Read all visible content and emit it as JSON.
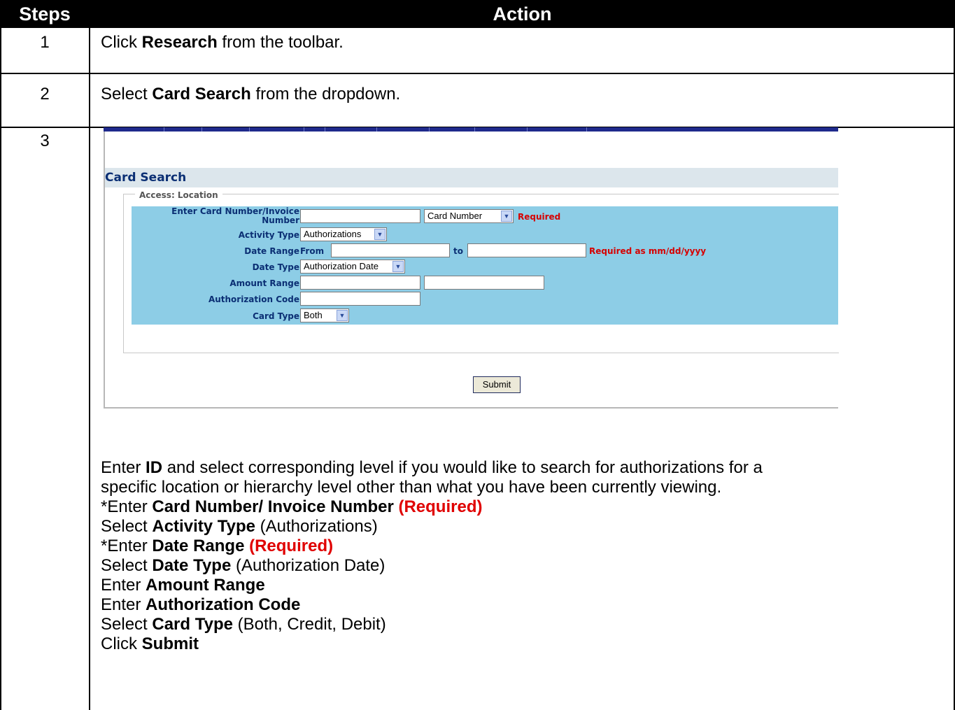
{
  "header": {
    "steps": "Steps",
    "action": "Action"
  },
  "rows": [
    {
      "num": "1",
      "pre": "Click ",
      "bold": "Research",
      "post": " from the toolbar."
    },
    {
      "num": "2",
      "pre": "Select ",
      "bold": "Card Search",
      "post": " from the dropdown."
    },
    {
      "num": "3"
    }
  ],
  "screenshot": {
    "title": "Card Search",
    "legend": "Access: Location",
    "fields": {
      "card_number_label_1": "Enter Card Number/Invoice",
      "card_number_label_2": "Number",
      "card_number_select": "Card Number",
      "required": "Required",
      "activity_type_label": "Activity Type",
      "activity_type_value": "Authorizations",
      "date_range_label": "Date Range",
      "from": "From",
      "to": "to",
      "date_required": "Required as mm/dd/yyyy",
      "date_type_label": "Date Type",
      "date_type_value": "Authorization Date",
      "amount_range_label": "Amount Range",
      "auth_code_label": "Authorization Code",
      "card_type_label": "Card Type",
      "card_type_value": "Both"
    },
    "submit": "Submit"
  },
  "instructions": {
    "line1_pre": "Enter ",
    "line1_bold": "ID",
    "line1_post": " and select corresponding level if you would like to search for authorizations for a",
    "line2": "specific location or hierarchy level other than what you have been currently viewing.",
    "line3_pre": "*Enter ",
    "line3_bold": "Card Number/ Invoice Number",
    "line3_red": "(Required)",
    "line4_pre": "Select ",
    "line4_bold": "Activity Type",
    "line4_post": " (Authorizations)",
    "line5_pre": "*Enter ",
    "line5_bold": "Date Range",
    "line5_red": "(Required)",
    "line6_pre": "Select ",
    "line6_bold": "Date Type",
    "line6_post": " (Authorization Date)",
    "line7_pre": "Enter ",
    "line7_bold": "Amount Range",
    "line8_pre": "Enter ",
    "line8_bold": "Authorization Code",
    "line9_pre": "Select ",
    "line9_bold": "Card Type",
    "line9_post": " (Both, Credit, Debit)",
    "line10_pre": "Click ",
    "line10_bold": "Submit"
  }
}
